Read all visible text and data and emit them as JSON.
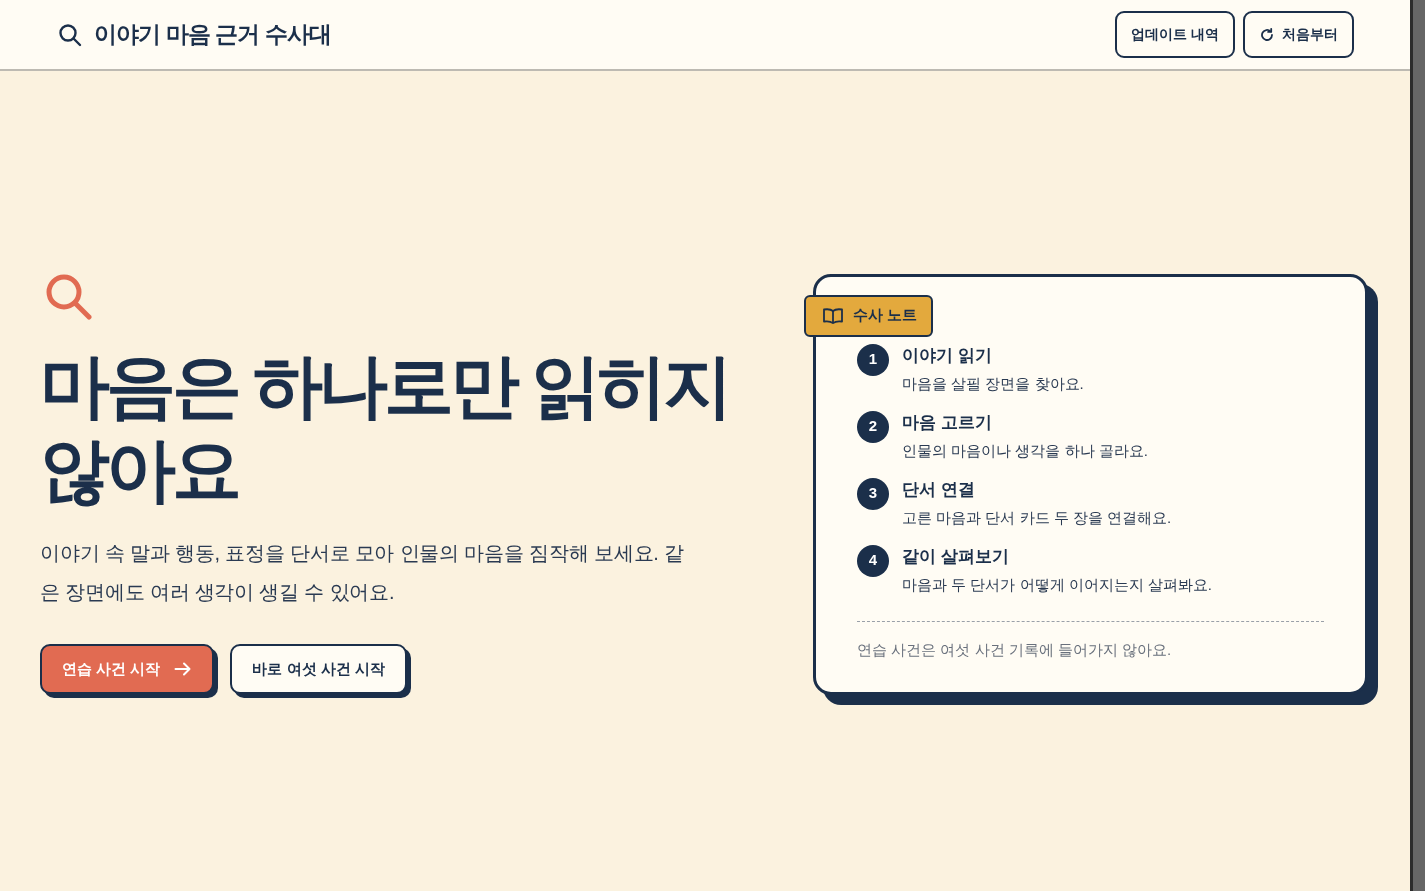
{
  "header": {
    "title": "이야기 마음 근거 수사대",
    "buttons": [
      {
        "label": "업데이트 내역",
        "kind": "plain"
      },
      {
        "label": "처음부터",
        "kind": "restart"
      }
    ]
  },
  "hero": {
    "heading": "마음은 하나로만 읽히지 않아요",
    "description": "이야기 속 말과 행동, 표정을 단서로 모아 인물의 마음을 짐작해 보세요. 같은 장면에도 여러 생각이 생길 수 있어요.",
    "buttons": [
      {
        "label": "연습 사건 시작",
        "kind": "primary"
      },
      {
        "label": "바로 여섯 사건 시작",
        "kind": "secondary"
      }
    ]
  },
  "notebook": {
    "badge": "수사 노트",
    "steps": [
      {
        "number": "1",
        "title": "이야기 읽기",
        "description": "마음을 살필 장면을 찾아요."
      },
      {
        "number": "2",
        "title": "마음 고르기",
        "description": "인물의 마음이나 생각을 하나 골라요."
      },
      {
        "number": "3",
        "title": "단서 연결",
        "description": "고른 마음과 단서 카드 두 장을 연결해요."
      },
      {
        "number": "4",
        "title": "같이 살펴보기",
        "description": "마음과 두 단서가 어떻게 이어지는지 살펴봐요."
      }
    ],
    "footnote": "연습 사건은 여섯 사건 기록에 들어가지 않아요."
  }
}
